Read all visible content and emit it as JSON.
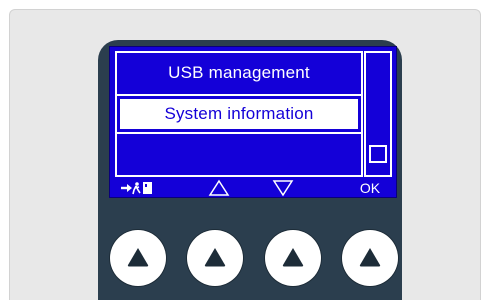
{
  "screen": {
    "menu_items": [
      "USB management",
      "System information"
    ],
    "selected_index": 1,
    "softkeys": {
      "exit_label": "→☰",
      "up_label": "△",
      "down_label": "▽",
      "ok_label": "OK"
    }
  },
  "colors": {
    "screen_blue": "#1400d8",
    "device_body": "#2b3e4e",
    "panel_bg": "#e8e8e8",
    "text_light": "#ffffff"
  },
  "icons": {
    "exit": "exit-door-icon",
    "up": "triangle-up-outline-icon",
    "down": "triangle-down-outline-icon",
    "hw_button": "triangle-up-filled-icon"
  }
}
